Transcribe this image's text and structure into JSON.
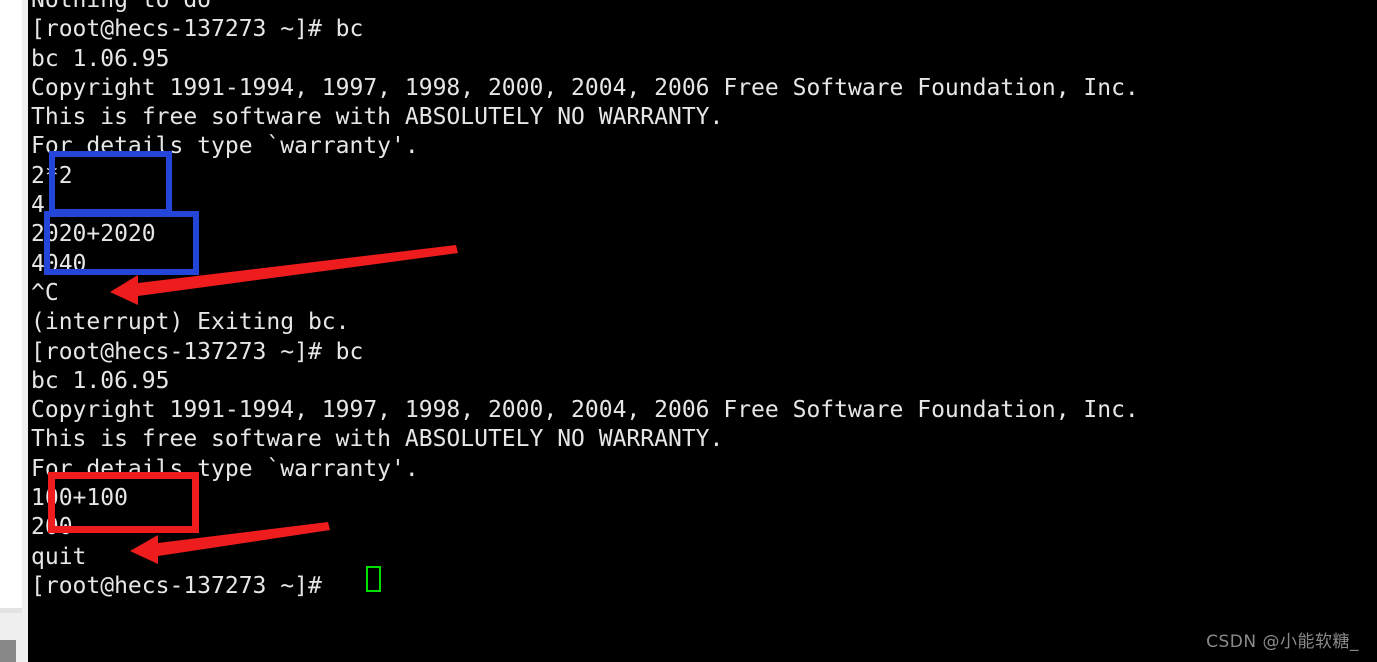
{
  "window": {
    "background_color": "#000000",
    "text_color": "#e6e6e6",
    "gutter_color": "#efefef"
  },
  "terminal": {
    "prompt": "[root@hecs-137273 ~]#",
    "cursor": {
      "name": "text-cursor",
      "color": "#00e000",
      "style": "hollow-block"
    },
    "lines": [
      "Nothing to do",
      "[root@hecs-137273 ~]# bc",
      "bc 1.06.95",
      "Copyright 1991-1994, 1997, 1998, 2000, 2004, 2006 Free Software Foundation, Inc.",
      "This is free software with ABSOLUTELY NO WARRANTY.",
      "For details type `warranty'.",
      "2*2",
      "4",
      "2020+2020",
      "4040",
      "^C",
      "(interrupt) Exiting bc.",
      "[root@hecs-137273 ~]# bc",
      "bc 1.06.95",
      "Copyright 1991-1994, 1997, 1998, 2000, 2004, 2006 Free Software Foundation, Inc.",
      "This is free software with ABSOLUTELY NO WARRANTY.",
      "For details type `warranty'.",
      "100+100",
      "200",
      "quit",
      "[root@hecs-137273 ~]# "
    ]
  },
  "annotations": {
    "boxes": [
      {
        "name": "blue-highlight-box-expression-1",
        "color": "#2346d8",
        "covers": [
          "2*2",
          "4"
        ]
      },
      {
        "name": "blue-highlight-box-expression-2",
        "color": "#2346d8",
        "covers": [
          "2020+2020",
          "4040"
        ]
      },
      {
        "name": "red-highlight-box-expression-3",
        "color": "#ee1c1c",
        "covers": [
          "100+100",
          "200"
        ]
      }
    ],
    "arrows": [
      {
        "name": "red-arrow-pointing-to-interrupt",
        "color": "#ee1c1c",
        "points_at": "^C"
      },
      {
        "name": "red-arrow-pointing-to-quit",
        "color": "#ee1c1c",
        "points_at": "quit"
      }
    ]
  },
  "watermark": {
    "text": "CSDN @小能软糖_",
    "color": "#8a8a8a"
  }
}
